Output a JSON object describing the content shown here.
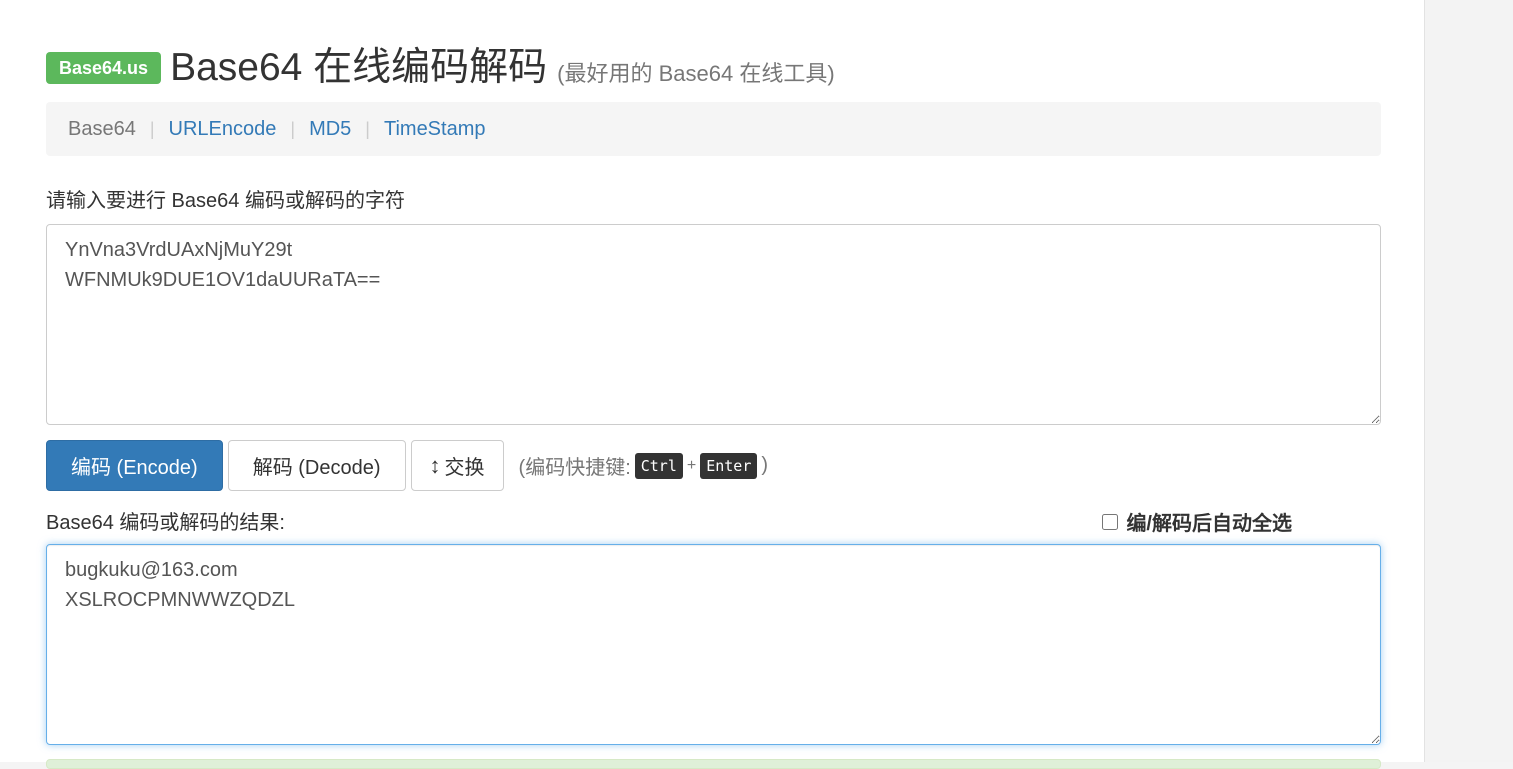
{
  "header": {
    "brand": "Base64.us",
    "title": "Base64 在线编码解码",
    "subtitle": "(最好用的 Base64 在线工具)"
  },
  "nav": {
    "items": [
      {
        "label": "Base64",
        "active": true
      },
      {
        "label": "URLEncode",
        "active": false
      },
      {
        "label": "MD5",
        "active": false
      },
      {
        "label": "TimeStamp",
        "active": false
      }
    ],
    "separator": "|"
  },
  "input": {
    "label": "请输入要进行 Base64 编码或解码的字符",
    "value": "YnVna3VrdUAxNjMuY29t\nWFNMUk9DUE1OV1daUURaTA=="
  },
  "actions": {
    "encode_label": "编码 (Encode)",
    "decode_label": "解码 (Decode)",
    "swap_icon": "↕",
    "swap_label": "交换",
    "hint_prefix": "(编码快捷键:",
    "hint_key1": "Ctrl",
    "hint_plus": "+",
    "hint_key2": "Enter",
    "hint_suffix": ")"
  },
  "result": {
    "label": "Base64 编码或解码的结果:",
    "auto_select_label": "编/解码后自动全选",
    "auto_select_checked": false,
    "value": "bugkuku@163.com\nXSLROCPMNWWZQDZL"
  },
  "colors": {
    "brand_green": "#5cb85c",
    "primary_blue": "#337ab7",
    "link_blue": "#337ab7"
  }
}
